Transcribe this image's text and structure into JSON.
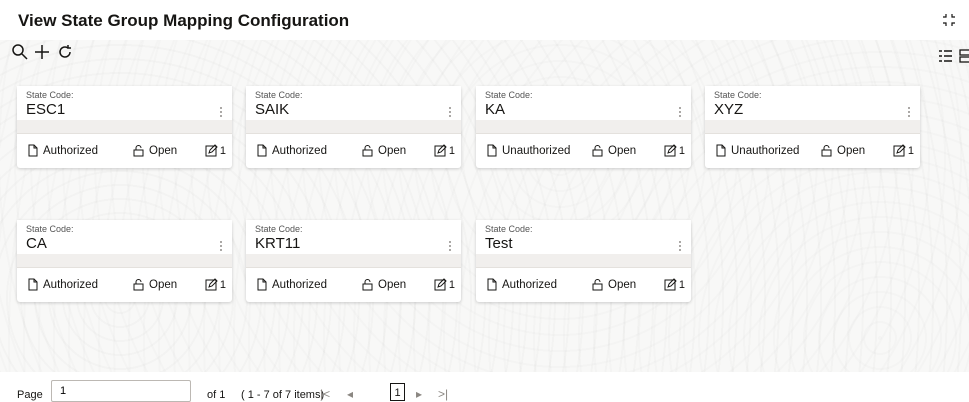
{
  "header": {
    "title": "View State Group Mapping Configuration"
  },
  "toolbar": {
    "search_icon": "search-icon",
    "add_icon": "plus-icon",
    "refresh_icon": "refresh-icon"
  },
  "cards": [
    {
      "label": "State Code:",
      "value": "ESC1",
      "status": "Authorized",
      "lock": "Open",
      "edits": "1"
    },
    {
      "label": "State Code:",
      "value": "SAIK",
      "status": "Authorized",
      "lock": "Open",
      "edits": "1"
    },
    {
      "label": "State Code:",
      "value": "KA",
      "status": "Unauthorized",
      "lock": "Open",
      "edits": "1"
    },
    {
      "label": "State Code:",
      "value": "XYZ",
      "status": "Unauthorized",
      "lock": "Open",
      "edits": "1"
    },
    {
      "label": "State Code:",
      "value": "CA",
      "status": "Authorized",
      "lock": "Open",
      "edits": "1"
    },
    {
      "label": "State Code:",
      "value": "KRT11",
      "status": "Authorized",
      "lock": "Open",
      "edits": "1"
    },
    {
      "label": "State Code:",
      "value": "Test",
      "status": "Authorized",
      "lock": "Open",
      "edits": "1"
    }
  ],
  "pager": {
    "label": "Page",
    "value": "1",
    "of_text": "of 1",
    "range_text": "( 1 - 7 of 7 items)",
    "first": "|<",
    "prev": "◂",
    "current": "1",
    "next": "▸",
    "last": ">|"
  },
  "colors": {
    "accent": "#161513",
    "band": "#f1efed",
    "background": "#f8f8f7"
  }
}
